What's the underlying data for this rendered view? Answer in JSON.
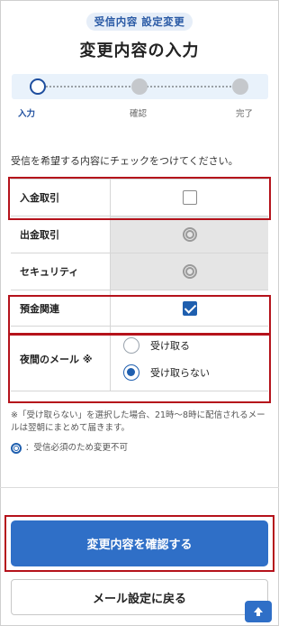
{
  "header": {
    "badge": "受信内容 設定変更",
    "title": "変更内容の入力"
  },
  "stepper": {
    "steps": [
      {
        "label": "入力",
        "state": "current"
      },
      {
        "label": "確認",
        "state": "todo"
      },
      {
        "label": "完了",
        "state": "todo"
      }
    ]
  },
  "instruction": "受信を希望する内容にチェックをつけてください。",
  "options": {
    "deposit": {
      "label": "入金取引",
      "checked": false
    },
    "withdrawal": {
      "label": "出金取引",
      "locked": true
    },
    "security": {
      "label": "セキュリティ",
      "locked": true
    },
    "savings": {
      "label": "預金関連",
      "checked": true
    },
    "night_mail": {
      "label": "夜間のメール ※",
      "choices": [
        {
          "label": "受け取る",
          "selected": false
        },
        {
          "label": "受け取らない",
          "selected": true
        }
      ]
    }
  },
  "notes": {
    "night_note": "※「受け取らない」を選択した場合、21時〜8時に配信されるメールは翌朝にまとめて届きます。",
    "locked_note": "：受信必須のため変更不可"
  },
  "buttons": {
    "confirm": "変更内容を確認する",
    "back": "メール設定に戻る"
  },
  "colors": {
    "primary": "#2f6fc7",
    "highlight": "#b5121b",
    "disabled_bg": "#e5e5e5"
  },
  "icons": {
    "locked": "double-circle-icon",
    "scroll_top": "arrow-up-icon"
  }
}
